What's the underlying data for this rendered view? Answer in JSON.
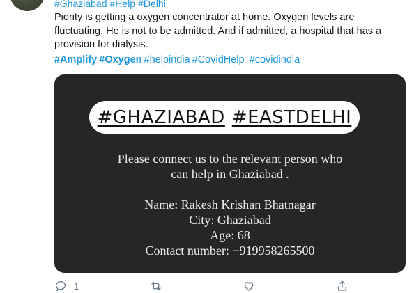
{
  "tweet": {
    "top_hashtags": [
      "#Ghaziabad",
      "#Help",
      "#Delhi"
    ],
    "text": "Piority is getting a oxygen concentrator at home. Oxygen levels are fluctuating. He is not to be admitted. And if admitted, a hospital that has a provision for dialysis.",
    "bottom_hashtags": [
      "#Amplify",
      "#Oxygen",
      "#helpindia",
      "#CovidHelp",
      "#covidindia"
    ],
    "media": {
      "pill_tag_1": "#GHAZIABAD",
      "pill_tag_2": "#EASTDELHI",
      "line_1": "Please connect us to the relevant person who",
      "line_2": "can help in Ghaziabad .",
      "name_line": "Name: Rakesh Krishan Bhatnagar",
      "city_line": "City: Ghaziabad",
      "age_line": "Age: 68",
      "contact_line": "Contact number: +919958265500"
    },
    "actions": {
      "reply_count": "1",
      "reply_icon": "reply-icon",
      "retweet_icon": "retweet-icon",
      "like_icon": "heart-icon",
      "share_icon": "share-icon"
    }
  }
}
